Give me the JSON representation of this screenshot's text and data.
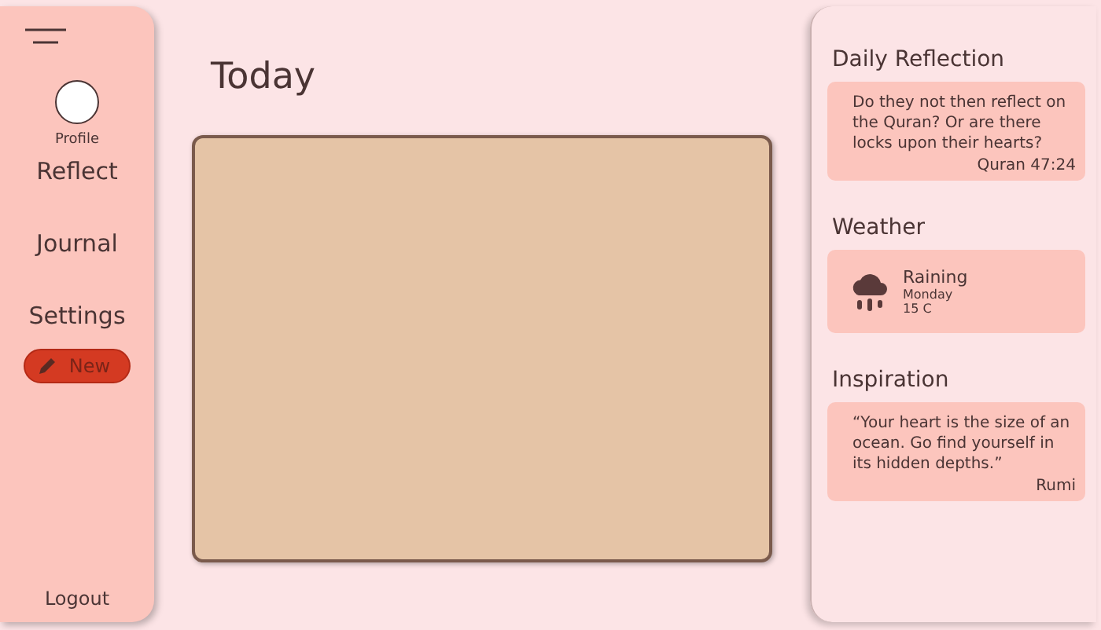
{
  "sidebar": {
    "profile_label": "Profile",
    "items": [
      {
        "label": "Reflect"
      },
      {
        "label": "Journal"
      },
      {
        "label": "Settings"
      }
    ],
    "new_button": "New",
    "logout": "Logout"
  },
  "main": {
    "title": "Today"
  },
  "right_panel": {
    "sections": [
      {
        "kind": "quote",
        "heading": "Daily Reflection",
        "text": "Do they not then reflect on the Quran? Or are there locks upon their hearts?",
        "source": "Quran 47:24"
      },
      {
        "kind": "weather",
        "heading": "Weather",
        "condition": "Raining",
        "day": "Monday",
        "temperature": "15 C"
      },
      {
        "kind": "quote",
        "heading": "Inspiration",
        "text": "“Your heart is the size of an ocean. Go find yourself in its hidden depths.”",
        "source": "Rumi"
      }
    ]
  }
}
